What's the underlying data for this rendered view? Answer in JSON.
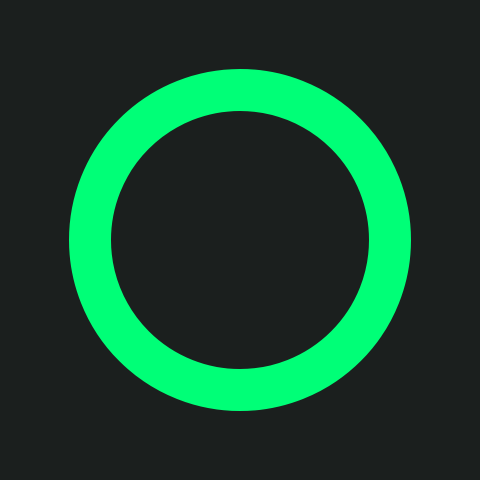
{
  "icon": {
    "name": "ring-icon",
    "ring_color": "#00ff77",
    "background_color": "#1b1f1e"
  }
}
